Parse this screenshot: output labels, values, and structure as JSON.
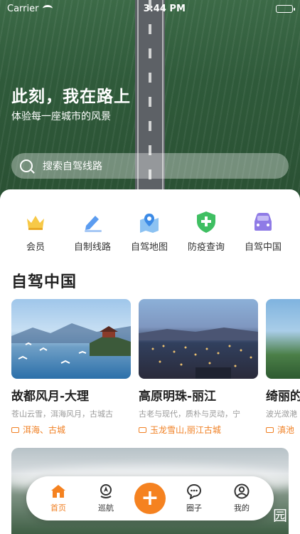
{
  "status_bar": {
    "carrier": "Carrier",
    "time": "3:44 PM"
  },
  "hero": {
    "title": "此刻，我在路上",
    "subtitle": "体验每一座城市的风景",
    "search_placeholder": "搜索自驾线路"
  },
  "quick_menu": [
    {
      "label": "会员",
      "icon": "crown-icon"
    },
    {
      "label": "自制线路",
      "icon": "pencil-icon"
    },
    {
      "label": "自驾地图",
      "icon": "map-pin-icon"
    },
    {
      "label": "防疫查询",
      "icon": "shield-cross-icon"
    },
    {
      "label": "自驾中国",
      "icon": "car-icon"
    }
  ],
  "section": {
    "title": "自驾中国"
  },
  "cards": [
    {
      "title": "故都风月-大理",
      "desc": "苍山云雪，洱海风月，古城古",
      "tag": "洱海、古城"
    },
    {
      "title": "高原明珠-丽江",
      "desc": "古老与现代，质朴与灵动，宁",
      "tag": "玉龙雪山,丽江古城"
    },
    {
      "title": "绮丽的",
      "desc": "波光潋滟",
      "tag": "滇池"
    }
  ],
  "tabbar": {
    "items": [
      {
        "label": "首页",
        "icon": "home-icon",
        "active": true
      },
      {
        "label": "巡航",
        "icon": "navigation-icon",
        "active": false
      },
      {
        "label": "圈子",
        "icon": "chat-bubble-icon",
        "active": false
      },
      {
        "label": "我的",
        "icon": "user-icon",
        "active": false
      }
    ],
    "plus": "+",
    "overlay_char": "园"
  },
  "colors": {
    "accent": "#f58220",
    "tag": "#f07f22"
  }
}
